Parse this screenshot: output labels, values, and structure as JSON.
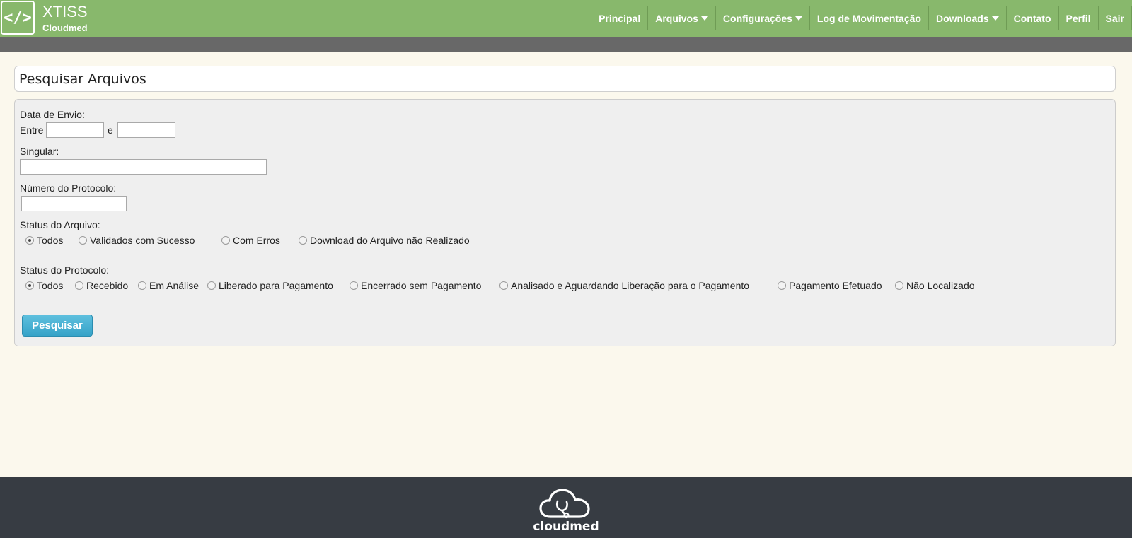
{
  "header": {
    "logo_glyph": "</>",
    "title": "XTISS",
    "subtitle": "Cloudmed",
    "nav": [
      {
        "label": "Principal",
        "dropdown": false
      },
      {
        "label": "Arquivos",
        "dropdown": true
      },
      {
        "label": "Configurações",
        "dropdown": true
      },
      {
        "label": "Log de Movimentação",
        "dropdown": false
      },
      {
        "label": "Downloads",
        "dropdown": true
      },
      {
        "label": "Contato",
        "dropdown": false
      },
      {
        "label": "Perfil",
        "dropdown": false
      },
      {
        "label": "Sair",
        "dropdown": false
      }
    ]
  },
  "page": {
    "title": "Pesquisar Arquivos"
  },
  "form": {
    "date_label": "Data de Envio:",
    "between_label": "Entre",
    "and_label": "e",
    "date_from_value": "",
    "date_to_value": "",
    "singular_label": "Singular:",
    "singular_value": "",
    "protocol_number_label": "Número do Protocolo:",
    "protocol_number_value": "",
    "file_status_label": "Status do Arquivo:",
    "file_status_options": [
      "Todos",
      "Validados com Sucesso",
      "Com Erros",
      "Download do Arquivo não Realizado"
    ],
    "file_status_selected": "Todos",
    "protocol_status_label": "Status do Protocolo:",
    "protocol_status_options": [
      "Todos",
      "Recebido",
      "Em Análise",
      "Liberado para Pagamento",
      "Encerrado sem Pagamento",
      "Analisado e Aguardando Liberação para o Pagamento",
      "Pagamento Efetuado",
      "Não Localizado"
    ],
    "protocol_status_selected": "Todos",
    "search_button": "Pesquisar"
  },
  "footer": {
    "brand": "cloudmed",
    "logo_icon": "cloud-stethoscope-icon"
  },
  "colors": {
    "header_green": "#88b86c",
    "subbar_gray": "#686868",
    "page_bg": "#fbf8ed",
    "button_blue": "#36a3c8",
    "footer_dark": "#373c43"
  }
}
